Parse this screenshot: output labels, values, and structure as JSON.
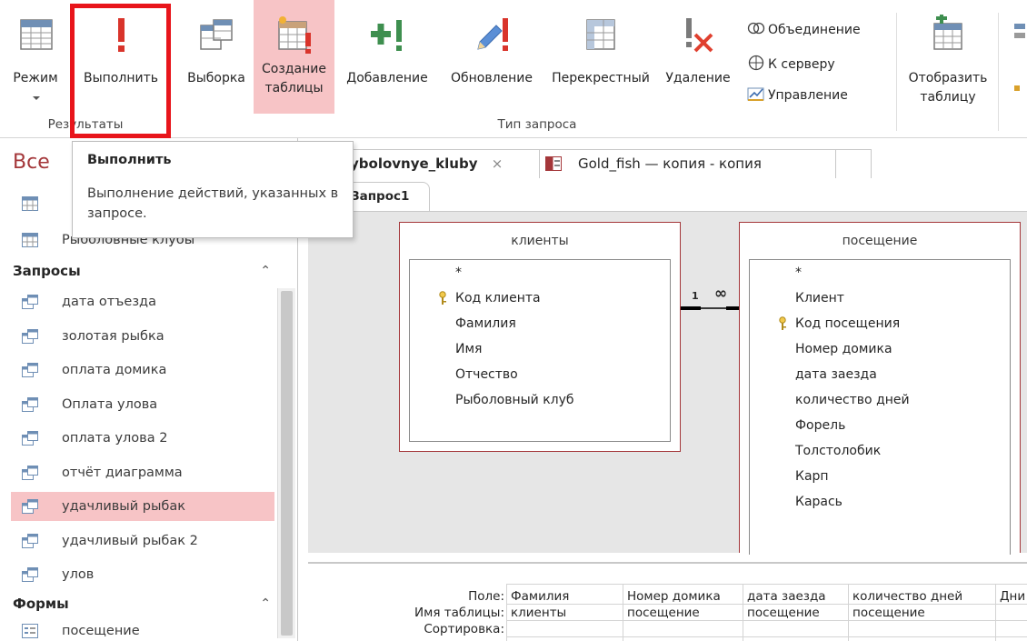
{
  "ribbon": {
    "results_group": "Результаты",
    "query_type_group": "Тип запроса",
    "buttons": {
      "mode": "Режим",
      "run": "Выполнить",
      "select": "Выборка",
      "make_table_1": "Создание",
      "make_table_2": "таблицы",
      "append": "Добавление",
      "update": "Обновление",
      "crosstab": "Перекрестный",
      "delete": "Удаление",
      "union": "Объединение",
      "pass_through": "К серверу",
      "data_definition": "Управление",
      "show_table_1": "Отобразить",
      "show_table_2": "таблицу"
    }
  },
  "tooltip": {
    "title": "Выполнить",
    "description": "Выполнение действий, указанных в запросе."
  },
  "nav": {
    "header": "Все",
    "items_top": [
      {
        "label": "Рыболовные клубы"
      }
    ],
    "queries_section": "Запросы",
    "queries": [
      {
        "label": "дата отъезда"
      },
      {
        "label": "золотая рыбка"
      },
      {
        "label": "оплата домика"
      },
      {
        "label": "Оплата улова"
      },
      {
        "label": "оплата улова 2"
      },
      {
        "label": "отчёт диаграмма"
      },
      {
        "label": "удачливый рыбак"
      },
      {
        "label": "удачливый рыбак 2"
      },
      {
        "label": "улов"
      }
    ],
    "forms_section": "Формы",
    "forms": [
      {
        "label": "посещение"
      }
    ],
    "collapse_glyph": "⌃"
  },
  "tabs": {
    "tab1": "ybolovnye_kluby",
    "tab1_close": "×",
    "tab2": "Gold_fish — копия - копия",
    "query_tab": "Запрос1"
  },
  "design": {
    "relation_one": "1",
    "relation_many": "∞",
    "table1": {
      "title": "клиенты",
      "fields": [
        "*",
        "Код клиента",
        "Фамилия",
        "Имя",
        "Отчество",
        "Рыболовный клуб"
      ]
    },
    "table2": {
      "title": "посещение",
      "fields": [
        "*",
        "Клиент",
        "Код посещения",
        "Номер домика",
        "дата заезда",
        "количество дней",
        "Форель",
        "Толстолобик",
        "Карп",
        "Карась"
      ]
    },
    "scroll_left": "◀"
  },
  "grid": {
    "row_labels": [
      "Поле:",
      "Имя таблицы:",
      "Сортировка:"
    ],
    "columns": [
      {
        "field": "Фамилия",
        "table": "клиенты"
      },
      {
        "field": "Номер домика",
        "table": "посещение"
      },
      {
        "field": "дата заезда",
        "table": "посещение"
      },
      {
        "field": "количество дней",
        "table": "посещение"
      },
      {
        "field": "Дни",
        "table": ""
      }
    ]
  },
  "colors": {
    "accent": "#a4373a",
    "highlight": "#f7c4c6",
    "frame": "#e8151b"
  }
}
